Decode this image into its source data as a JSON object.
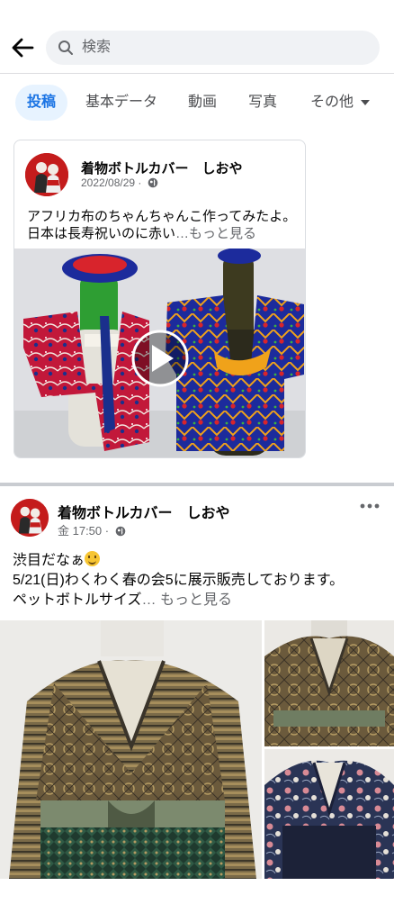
{
  "search": {
    "placeholder": "検索"
  },
  "tabs": [
    {
      "label": "投稿",
      "active": true
    },
    {
      "label": "基本データ",
      "active": false
    },
    {
      "label": "動画",
      "active": false
    },
    {
      "label": "写真",
      "active": false
    },
    {
      "label": "その他",
      "active": false
    }
  ],
  "posts": [
    {
      "author": "着物ボトルカバー　しおや",
      "timestamp": "2022/08/29",
      "text": "アフリカ布のちゃんちゃんこ作ってみたよ。日本は長寿祝いのに赤い",
      "see_more": "…もっと見る",
      "media_type": "video"
    },
    {
      "author": "着物ボトルカバー　しおや",
      "timestamp": "金 17:50",
      "text_line1": "渋目だなぁ",
      "text_line2": "5/21(日)わくわく春の会5に展示販売しております。",
      "text_line3": "ペットボトルサイズ",
      "see_more": "… もっと見る",
      "photo_count": 3
    }
  ],
  "colors": {
    "accent": "#1b74e4",
    "accent_bg": "#e7f3ff",
    "secondary_text": "#65676b"
  }
}
